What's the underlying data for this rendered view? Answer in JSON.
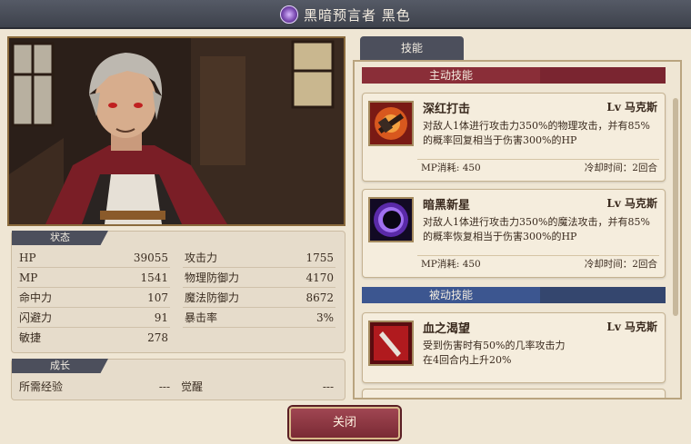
{
  "title": "黑暗预言者 黑色",
  "portrait": {
    "icon": "character-portrait"
  },
  "stats": {
    "header": "状态",
    "left": [
      {
        "label": "HP",
        "value": "39055"
      },
      {
        "label": "MP",
        "value": "1541"
      },
      {
        "label": "命中力",
        "value": "107"
      },
      {
        "label": "闪避力",
        "value": "91"
      },
      {
        "label": "敏捷",
        "value": "278"
      }
    ],
    "right": [
      {
        "label": "攻击力",
        "value": "1755"
      },
      {
        "label": "物理防御力",
        "value": "4170"
      },
      {
        "label": "魔法防御力",
        "value": "8672"
      },
      {
        "label": "暴击率",
        "value": "3%"
      }
    ]
  },
  "growth": {
    "header": "成长",
    "exp_label": "所需经验",
    "exp_value": "---",
    "awaken_label": "觉醒",
    "awaken_value": "---"
  },
  "close_label": "关闭",
  "skills_tab": "技能",
  "active_header": "主动技能",
  "passive_header": "被动技能",
  "skills": [
    {
      "name": "深红打击",
      "lv": "Lv 马克斯",
      "desc": "对敌人1体进行攻击力350%的物理攻击，并有85%的概率回复相当于伤害300%的HP",
      "mp": "MP消耗: 450",
      "cd": "冷却时间：2回合",
      "icon": "crimson-strike-icon"
    },
    {
      "name": "暗黑新星",
      "lv": "Lv 马克斯",
      "desc": "对敌人1体进行攻击力350%的魔法攻击，并有85%的概率恢复相当于伤害300%的HP",
      "mp": "MP消耗: 450",
      "cd": "冷却时间：2回合",
      "icon": "dark-nova-icon"
    },
    {
      "name": "血之渴望",
      "lv": "Lv 马克斯",
      "desc": "受到伤害时有50%的几率攻击力在4回合内上升20%",
      "icon": "blood-thirst-icon"
    }
  ],
  "colors": {
    "active_accent": "#8a2e38",
    "passive_accent": "#3c5690",
    "tab_dark": "#4c4f5c"
  }
}
